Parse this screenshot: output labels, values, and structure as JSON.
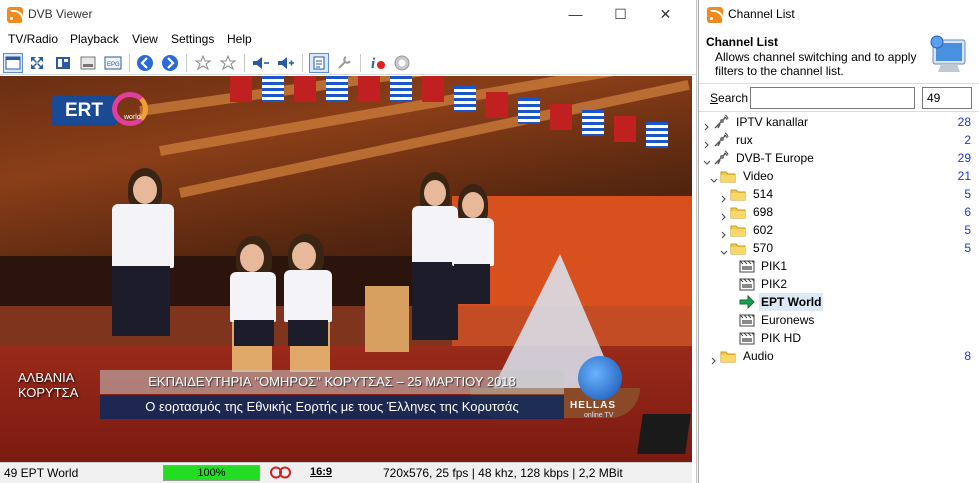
{
  "viewer": {
    "title": "DVB Viewer",
    "controls": {
      "minimize": "—",
      "maximize": "☐",
      "close": "✕"
    },
    "menu": [
      "TV/Radio",
      "Playback",
      "View",
      "Settings",
      "Help"
    ],
    "toolbar_icons": [
      "window-icon",
      "fullscreen-icon",
      "teletext-icon",
      "osd-icon",
      "epg-icon",
      "back-icon",
      "forward-icon",
      "favorite-icon",
      "favorite-add-icon",
      "volume-down-icon",
      "volume-up-icon",
      "channel-list-icon",
      "tools-icon",
      "info-icon",
      "record-icon"
    ]
  },
  "video": {
    "channel_logo": "ERT",
    "channel_logo_sub": "world",
    "location_line1": "ΑΛΒΑΝΙΑ",
    "location_line2": "ΚΟΡΥΤΣΑ",
    "headline": "ΕΚΠΑΙΔΕΥΤΗΡΙΑ \"ΟΜΗΡΟΣ\" ΚΟΡΥΤΣΑΣ – 25 ΜΑΡΤΙΟΥ 2018",
    "subheadline": "Ο εορτασμός της Εθνικής Εορτής με τους Έλληνες της Κορυτσάς",
    "partner_logo": "HELLAS",
    "partner_logo_sub": "online TV"
  },
  "status": {
    "channel": "49 EPT World",
    "progress": "100%",
    "progress_value": 1.0,
    "aspect": "16:9",
    "stream_info": "720x576, 25 fps | 48 khz, 128 kbps | 2,2 MBit"
  },
  "channel_list": {
    "title": "Channel List",
    "header_title": "Channel List",
    "header_desc": "Allows channel switching and to apply filters to the channel list.",
    "search_label": "Search",
    "search_value": "",
    "channel_number": "49",
    "tree": [
      {
        "label": "IPTV kanallar",
        "count": "28",
        "type": "network",
        "expanded": false,
        "level": 0
      },
      {
        "label": "rux",
        "count": "2",
        "type": "network",
        "expanded": false,
        "level": 0
      },
      {
        "label": "DVB-T Europe",
        "count": "29",
        "type": "network",
        "expanded": true,
        "level": 0
      },
      {
        "label": "Video",
        "count": "21",
        "type": "folder",
        "expanded": true,
        "level": 1
      },
      {
        "label": "514",
        "count": "5",
        "type": "folder",
        "expanded": false,
        "level": 2
      },
      {
        "label": "698",
        "count": "6",
        "type": "folder",
        "expanded": false,
        "level": 2
      },
      {
        "label": "602",
        "count": "5",
        "type": "folder",
        "expanded": false,
        "level": 2
      },
      {
        "label": "570",
        "count": "5",
        "type": "folder",
        "expanded": true,
        "level": 2
      },
      {
        "label": "PIK1",
        "count": "",
        "type": "channel",
        "level": 3
      },
      {
        "label": "PIK2",
        "count": "",
        "type": "channel",
        "level": 3
      },
      {
        "label": "EPT World",
        "count": "",
        "type": "channel-active",
        "level": 3,
        "selected": true
      },
      {
        "label": "Euronews",
        "count": "",
        "type": "channel",
        "level": 3
      },
      {
        "label": "PIK HD",
        "count": "",
        "type": "channel",
        "level": 3
      },
      {
        "label": "Audio",
        "count": "8",
        "type": "folder",
        "expanded": false,
        "level": 1
      }
    ]
  },
  "colors": {
    "accent": "#1a3ad0",
    "progress": "#22dd22",
    "app_icon": "#f08a1c",
    "selection": "#dce9f7"
  }
}
